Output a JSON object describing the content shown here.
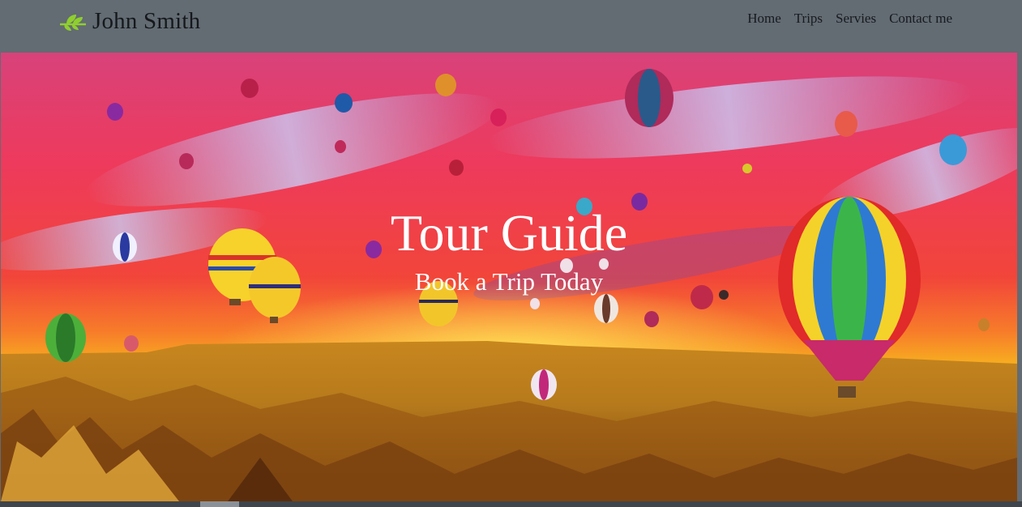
{
  "brand": {
    "name": "John Smith",
    "icon": "leaf-icon",
    "icon_color": "#8fcf2e"
  },
  "nav": {
    "items": [
      {
        "label": "Home"
      },
      {
        "label": "Trips"
      },
      {
        "label": "Servies"
      },
      {
        "label": "Contact me"
      }
    ]
  },
  "hero": {
    "title": "Tour Guide",
    "subtitle": "Book a Trip Today",
    "image": "hot-air-balloons-over-cappadocia-sunset"
  },
  "colors": {
    "navbar_bg": "#636b73",
    "brand_text": "#15191c",
    "hero_text": "#ffffff",
    "sky_top": "#d8427a",
    "sky_horizon": "#f7b21f",
    "ground": "#b67a1c"
  }
}
